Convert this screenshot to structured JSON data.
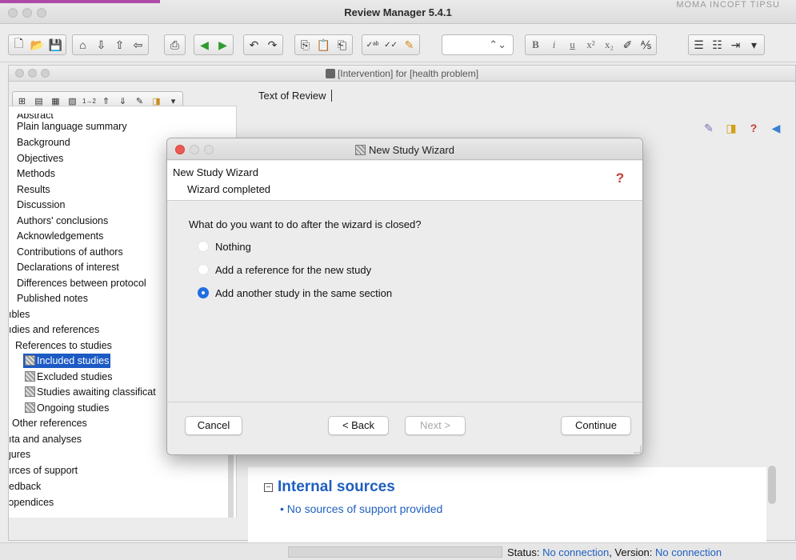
{
  "app": {
    "title": "Review Manager 5.4.1",
    "top_right_text": "MOMA   INCOFT   TIPSU"
  },
  "colors": {
    "accent": "#1f5fbf",
    "selection": "#1c5ac4",
    "help": "#c53b2e",
    "radio_on": "#1f6fe0"
  },
  "toolbar": {
    "combo_arrow": "⌃⌄",
    "format": {
      "bold": "B",
      "italic": "i",
      "underline": "u",
      "superscript": "x²",
      "subscript": "x₂"
    }
  },
  "document": {
    "title": "[Intervention] for [health problem]",
    "tab": "Text of Review"
  },
  "tree": {
    "items": [
      "Abstract",
      "Plain language summary",
      "Background",
      "Objectives",
      "Methods",
      "Results",
      "Discussion",
      "Authors' conclusions",
      "Acknowledgements",
      "Contributions of authors",
      "Declarations of interest",
      "Differences between protocol",
      "Published notes",
      "ıbles",
      "ıdies and references",
      "References to studies",
      "Included studies",
      "Excluded studies",
      "Studies awaiting classificat",
      "Ongoing studies",
      "Other references",
      "ıta and analyses",
      "ȷures",
      "ırces of support",
      "edback",
      "ɔpendices"
    ]
  },
  "content": {
    "heading": "Internal sources",
    "collapse_glyph": "−",
    "item": "• No sources of support provided"
  },
  "status": {
    "label": "Status: ",
    "value": "No connection",
    "version_label": ", Version: ",
    "version_value": "No connection"
  },
  "dialog": {
    "title": "New Study Wizard",
    "header_title": "New Study Wizard",
    "header_sub": "Wizard completed",
    "help_glyph": "?",
    "question": "What do you want to do after the wizard is closed?",
    "options": [
      {
        "label": "Nothing",
        "selected": false
      },
      {
        "label": "Add a reference for the new study",
        "selected": false
      },
      {
        "label": "Add another study in the same section",
        "selected": true
      }
    ],
    "buttons": {
      "cancel": "Cancel",
      "back": "< Back",
      "next": "Next >",
      "continue": "Continue"
    }
  }
}
